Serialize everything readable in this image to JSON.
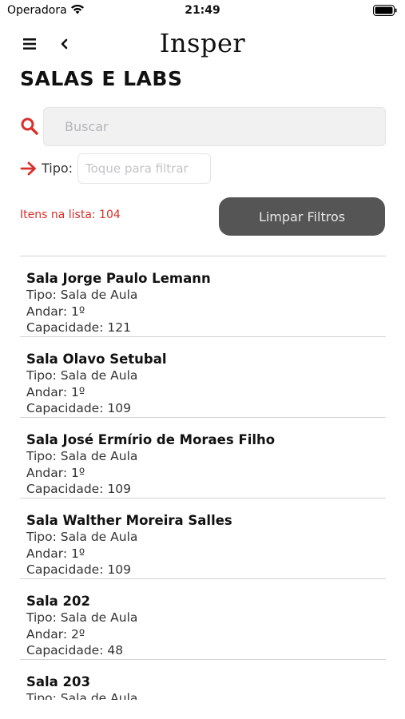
{
  "status": {
    "carrier": "Operadora",
    "time": "21:49"
  },
  "header": {
    "logo": "Insper"
  },
  "page_title": "SALAS E LABS",
  "search": {
    "placeholder": "Buscar",
    "value": ""
  },
  "filter": {
    "label": "Tipo:",
    "placeholder": "Toque para filtrar"
  },
  "count_text": "Itens na lista: 104",
  "clear_button": "Limpar Filtros",
  "items": [
    {
      "name": "Sala Jorge Paulo Lemann",
      "tipo": "Tipo: Sala de Aula",
      "andar": "Andar: 1º",
      "capacidade": "Capacidade: 121"
    },
    {
      "name": "Sala Olavo Setubal",
      "tipo": "Tipo: Sala de Aula",
      "andar": "Andar: 1º",
      "capacidade": "Capacidade: 109"
    },
    {
      "name": "Sala José Ermírio de Moraes Filho",
      "tipo": "Tipo: Sala de Aula",
      "andar": "Andar: 1º",
      "capacidade": "Capacidade: 109"
    },
    {
      "name": "Sala Walther Moreira Salles",
      "tipo": "Tipo: Sala de Aula",
      "andar": "Andar: 1º",
      "capacidade": "Capacidade: 109"
    },
    {
      "name": "Sala 202",
      "tipo": "Tipo: Sala de Aula",
      "andar": "Andar: 2º",
      "capacidade": "Capacidade: 48"
    },
    {
      "name": "Sala 203",
      "tipo": "Tipo: Sala de Aula",
      "andar": "",
      "capacidade": ""
    }
  ],
  "colors": {
    "accent_red": "#d9302b",
    "button_gray": "#555555",
    "divider": "#d4d4d4"
  },
  "icons": [
    "wifi-icon",
    "battery-icon",
    "menu-icon",
    "back-icon",
    "search-icon",
    "arrow-right-icon"
  ]
}
